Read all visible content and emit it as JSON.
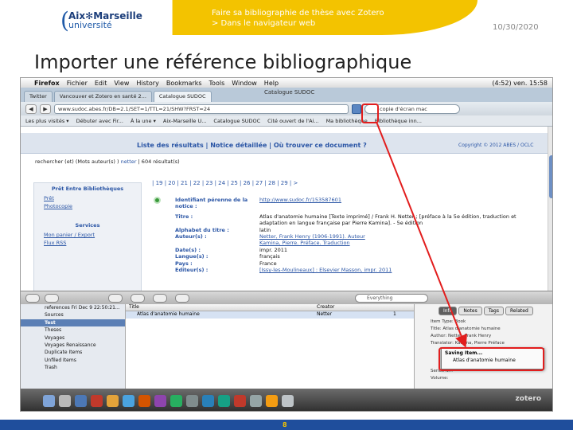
{
  "header": {
    "logo_line1": "Aix✻Marseille",
    "logo_line2": "université",
    "subtitle_line1": "Faire sa bibliographie de thèse avec Zotero",
    "subtitle_line2": "> Dans le navigateur web",
    "date": "10/30/2020"
  },
  "slide": {
    "title": "Importer une référence bibliographique",
    "page_number": "8"
  },
  "browser": {
    "menu": [
      "Firefox",
      "Fichier",
      "Edit",
      "View",
      "History",
      "Bookmarks",
      "Tools",
      "Window",
      "Help"
    ],
    "clock": "(4:52)  ven. 15:58",
    "window_title": "Catalogue SUDOC",
    "tabs": [
      "Twitter",
      "Vancouver et Zotero en santé 2...",
      "Catalogue SUDOC"
    ],
    "url": "www.sudoc.abes.fr/DB=2.1/SET=1/TTL=21/SHW?FRST=24",
    "search_value": "copie d'écran mac",
    "bookmarks": [
      "Les plus visités ▾",
      "Débuter avec Fir...",
      "À la une ▾",
      "Aix-Marseille U...",
      "Catalogue SUDOC",
      "Cité ouvert de l'Ai...",
      "Ma bibliothèque",
      "Bibliothèque inn..."
    ]
  },
  "sudoc": {
    "nav_links": "Liste des résultats | Notice détaillée | Où trouver ce document ?",
    "copyright": "Copyright © 2012 ABES / OCLC",
    "query_label": "rechercher (et) (Mots auteur(s) )",
    "query_term": "netter",
    "query_count": "| 604 résultat(s)",
    "pager": "| 19 | 20 | 21 | 22 | 23 | 24 | 25 | 26 | 27 | 28 | 29 | >",
    "left_head": "Prêt Entre Bibliothèques",
    "left_links": [
      "Prêt",
      "Photocopie"
    ],
    "services_head": "Services",
    "services_links": [
      "Mon panier / Export",
      "Flux RSS"
    ],
    "fields": [
      {
        "label": "Identifiant pérenne de la notice :",
        "value": "http://www.sudoc.fr/153587601",
        "link": true
      },
      {
        "label": "Titre :",
        "value": "Atlas d'anatomie humaine [Texte imprimé] / Frank H. Netter ; [préface à la 5e édition, traduction et adaptation en langue française par Pierre Kamina]. - 5e édition",
        "link": false
      },
      {
        "label": "Alphabet du titre :",
        "value": "latin",
        "link": false
      },
      {
        "label": "Auteur(s) :",
        "value": "Netter, Frank Henry (1906-1991). Auteur",
        "link": false
      },
      {
        "label": "",
        "value": "Kamina, Pierre. Préface. Traduction",
        "link": false
      },
      {
        "label": "Date(s) :",
        "value": "impr. 2011",
        "link": false
      },
      {
        "label": "Langue(s) :",
        "value": "français",
        "link": false
      },
      {
        "label": "Pays :",
        "value": "France",
        "link": false
      },
      {
        "label": "Editeur(s) :",
        "value": "[Issy-les-Moulineaux] : Elsevier Masson, impr. 2011",
        "link": false
      }
    ]
  },
  "zotero": {
    "search_placeholder": "Everything",
    "collections": [
      "references Fri Dec  9 22:50:21...",
      "Sources",
      "Test",
      "Theses",
      "Voyages",
      "Voyages Renaissance",
      "Duplicate Items",
      "Unfiled Items",
      "Trash"
    ],
    "selected_collection_index": 2,
    "col_title": "Title",
    "col_creator": "Creator",
    "item_title": "Atlas d'anatomie humaine",
    "item_creator": "Netter",
    "item_count": "1",
    "tabs": [
      "Info",
      "Notes",
      "Tags",
      "Related"
    ],
    "info_lines": [
      "Item Type: Book",
      "Title: Atlas d'anatomie humaine",
      "Author: Netter, Frank Henry",
      "Translator: Kamina, Pierre Préface",
      "Series N...",
      "Volume:"
    ],
    "popup_title": "Saving Item...",
    "popup_item": "Atlas d'anatomie humaine",
    "logo": "zotero"
  }
}
